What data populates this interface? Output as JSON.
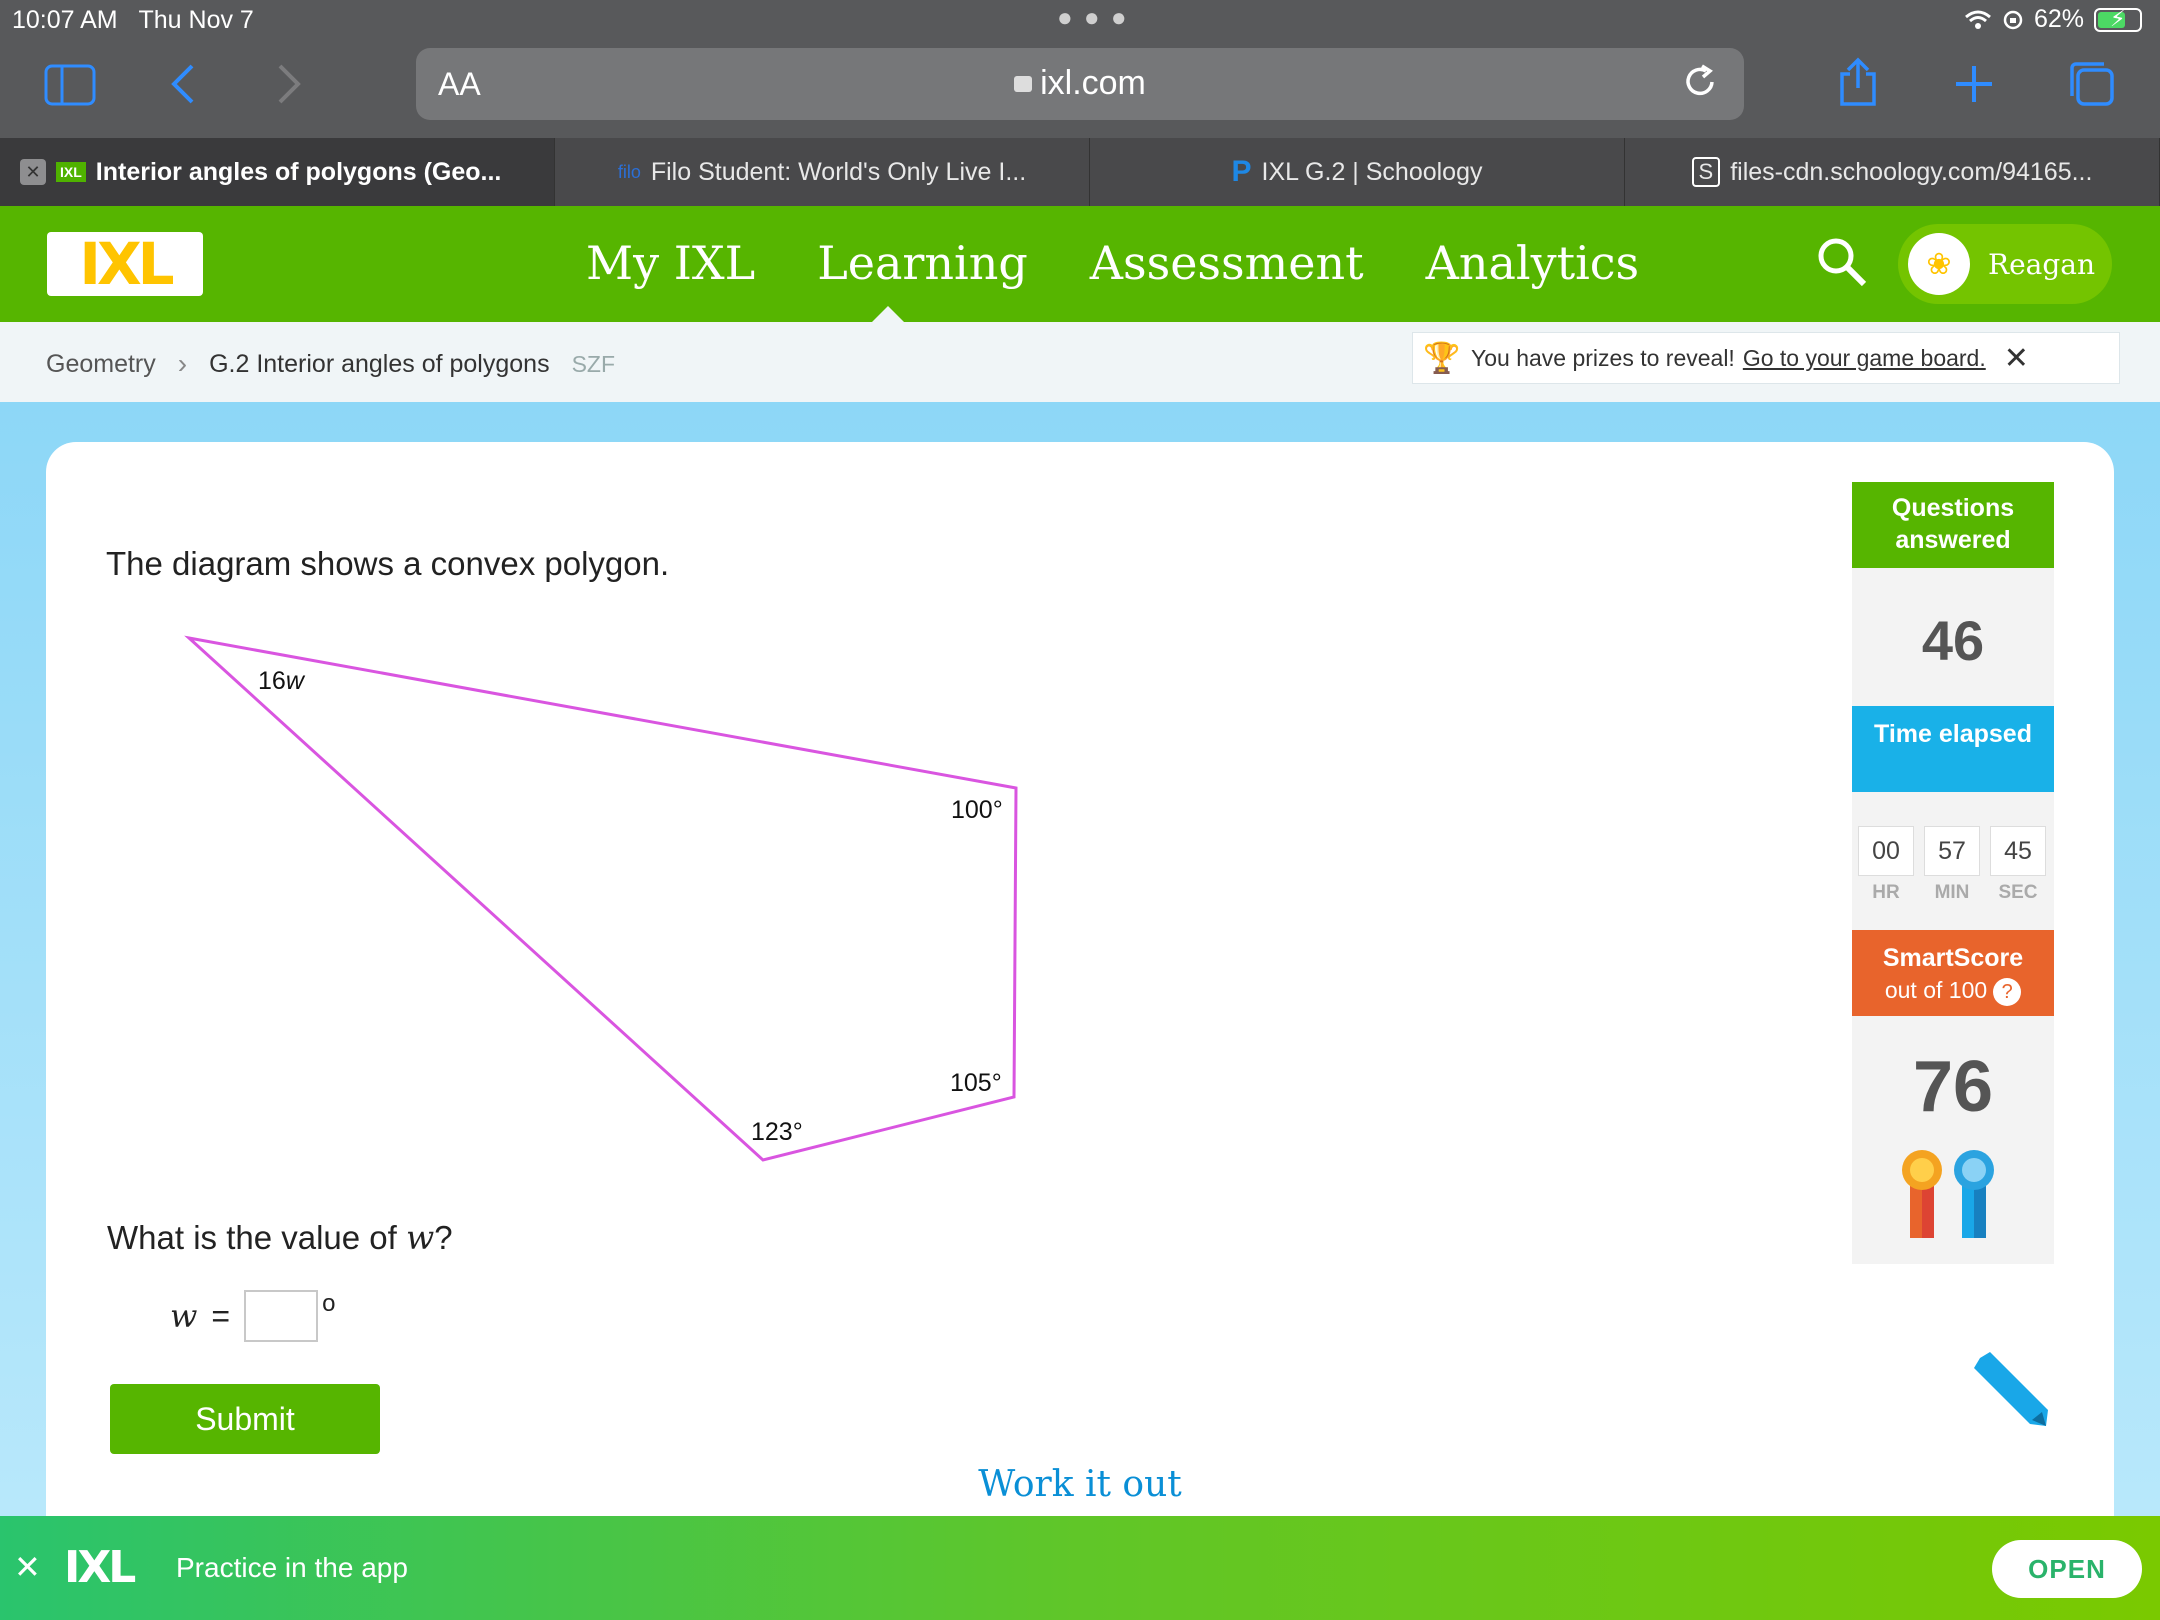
{
  "status": {
    "time": "10:07 AM",
    "date": "Thu Nov 7",
    "battery": "62%"
  },
  "browser": {
    "aa_label": "AA",
    "url": "ixl.com",
    "tabs": [
      {
        "label": "Interior angles of polygons (Geo...",
        "favicon": "IXL"
      },
      {
        "label": "Filo Student: World's Only Live I...",
        "favicon": "filo"
      },
      {
        "label": "IXL G.2 | Schoology",
        "favicon": "P"
      },
      {
        "label": "files-cdn.schoology.com/94165...",
        "favicon": "S"
      }
    ]
  },
  "header": {
    "logo": "IXL",
    "nav": [
      "My IXL",
      "Learning",
      "Assessment",
      "Analytics"
    ],
    "user": "Reagan"
  },
  "breadcrumb": {
    "subject": "Geometry",
    "skill": "G.2 Interior angles of polygons",
    "code": "SZF"
  },
  "prize": {
    "text": "You have prizes to reveal!",
    "link": "Go to your game board."
  },
  "question": {
    "prompt": "The diagram shows a convex polygon.",
    "angles": {
      "a": "16",
      "a_var": "w",
      "b": "100°",
      "c": "105°",
      "d": "123°"
    },
    "ask_prefix": "What is the value of ",
    "ask_var": "w",
    "ask_suffix": "?",
    "answer_var": "w",
    "answer_eq": "=",
    "answer_value": "",
    "deg_symbol": "o",
    "submit_label": "Submit",
    "work_it_out": "Work it out"
  },
  "stats": {
    "questions_answered_label": "Questions answered",
    "questions_answered": "46",
    "time_elapsed_label": "Time elapsed",
    "hr": "00",
    "min": "57",
    "sec": "45",
    "hr_label": "HR",
    "min_label": "MIN",
    "sec_label": "SEC",
    "smartscore_label": "SmartScore",
    "smartscore_sub": "out of 100",
    "smartscore_help": "?",
    "smartscore": "76"
  },
  "app_banner": {
    "logo": "IXL",
    "text": "Practice in the app",
    "open_label": "OPEN"
  },
  "colors": {
    "ixl_green": "#56b500",
    "time_blue": "#19b1e8",
    "smartscore_orange": "#e8642c",
    "polygon": "#d955e0",
    "link_blue": "#0a8fd6"
  }
}
